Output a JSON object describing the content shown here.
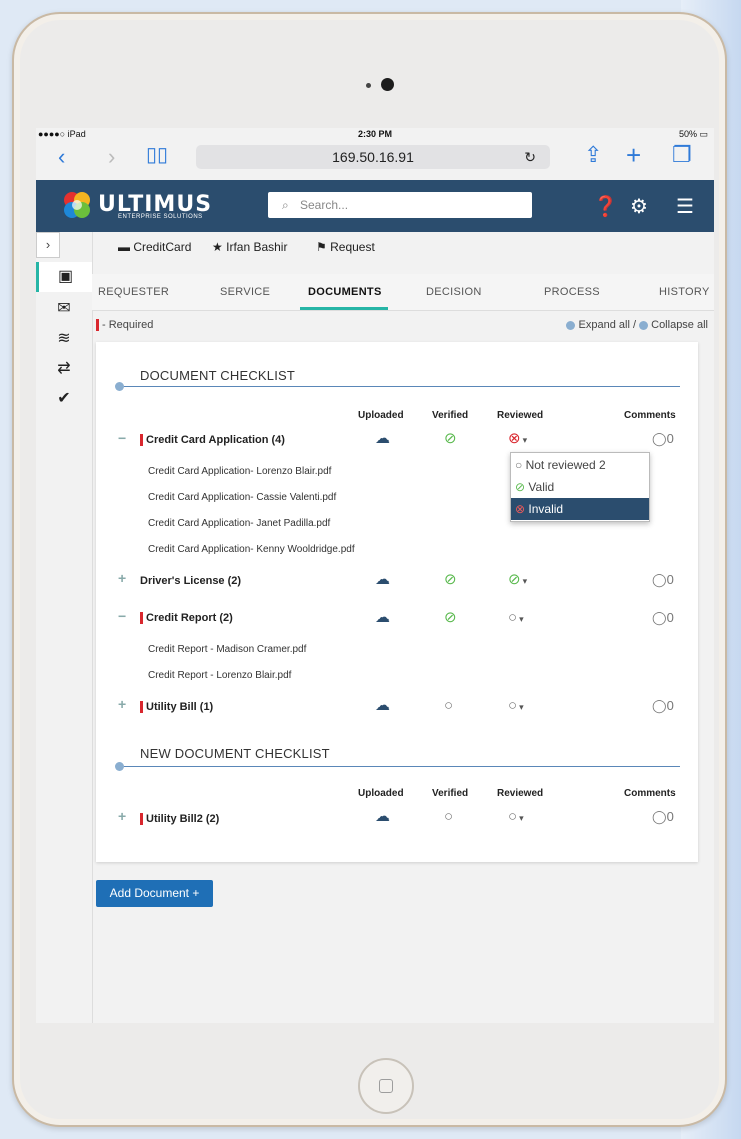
{
  "status_bar": {
    "left": "●●●●○ iPad",
    "time": "2:30 PM",
    "right": "50%"
  },
  "browser": {
    "url": "169.50.16.91"
  },
  "app": {
    "brand": "ULTIMUS",
    "brand_sub": "ENTERPRISE SOLUTIONS",
    "search_placeholder": "Search..."
  },
  "chips": [
    "CreditCard",
    "Irfan Bashir",
    "Request"
  ],
  "tabs": [
    "REQUESTER",
    "SERVICE",
    "DOCUMENTS",
    "DECISION",
    "PROCESS",
    "HISTORY"
  ],
  "required_label": "- Required",
  "expand_label": "Expand all",
  "collapse_label": "Collapse all",
  "columns": {
    "uploaded": "Uploaded",
    "verified": "Verified",
    "reviewed": "Reviewed",
    "comments": "Comments"
  },
  "section1": {
    "title": "DOCUMENT CHECKLIST",
    "rows": [
      {
        "label": "Credit Card Application (4)",
        "comments": "0",
        "files": [
          "Credit Card Application- Lorenzo Blair.pdf",
          "Credit Card Application- Cassie Valenti.pdf",
          "Credit Card Application- Janet Padilla.pdf",
          "Credit Card Application- Kenny Wooldridge.pdf"
        ]
      },
      {
        "label": "Driver's License (2)",
        "comments": "0"
      },
      {
        "label": "Credit Report (2)",
        "comments": "0",
        "files": [
          "Credit Report - Madison Cramer.pdf",
          "Credit Report - Lorenzo Blair.pdf"
        ]
      },
      {
        "label": "Utility Bill (1)",
        "comments": "0"
      }
    ]
  },
  "section2": {
    "title": "NEW DOCUMENT CHECKLIST",
    "rows": [
      {
        "label": "Utility Bill2 (2)",
        "comments": "0"
      }
    ]
  },
  "review_menu": [
    "Not reviewed 2",
    "Valid",
    "Invalid"
  ],
  "add_document": "Add Document +",
  "colors": {
    "header": "#2b4d6e",
    "accent": "#26b5a6",
    "required": "#d9272e",
    "valid": "#59b94d",
    "button": "#1f6fb6"
  }
}
